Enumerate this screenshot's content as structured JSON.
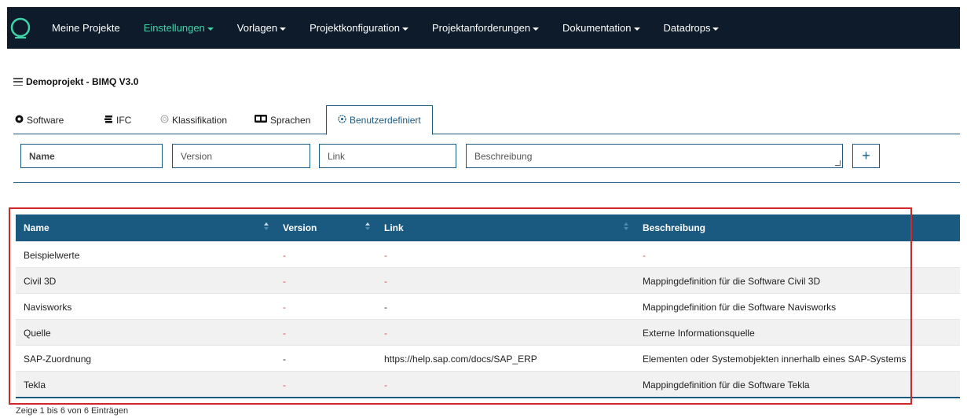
{
  "nav": {
    "items": [
      {
        "label": "Meine Projekte",
        "caret": false,
        "active": false
      },
      {
        "label": "Einstellungen",
        "caret": true,
        "active": true
      },
      {
        "label": "Vorlagen",
        "caret": true,
        "active": false
      },
      {
        "label": "Projektkonfiguration",
        "caret": true,
        "active": false
      },
      {
        "label": "Projektanforderungen",
        "caret": true,
        "active": false
      },
      {
        "label": "Dokumentation",
        "caret": true,
        "active": false
      },
      {
        "label": "Datadrops",
        "caret": true,
        "active": false
      }
    ]
  },
  "project": {
    "title": "Demoprojekt - BIMQ V3.0"
  },
  "tabs": [
    {
      "label": "Software",
      "icon": "software-icon"
    },
    {
      "label": "IFC",
      "icon": "ifc-stack-icon"
    },
    {
      "label": "Klassifikation",
      "icon": "classification-icon"
    },
    {
      "label": "Sprachen",
      "icon": "language-icon"
    },
    {
      "label": "Benutzerdefiniert",
      "icon": "custom-icon"
    }
  ],
  "form": {
    "name_placeholder": "Name",
    "version_placeholder": "Version",
    "link_placeholder": "Link",
    "description_placeholder": "Beschreibung",
    "add_label": "+"
  },
  "table": {
    "headers": [
      "Name",
      "Version",
      "Link",
      "Beschreibung"
    ],
    "rows": [
      {
        "name": "Beispielwerte",
        "version": "-",
        "link": "-",
        "description": "-"
      },
      {
        "name": "Civil 3D",
        "version": "-",
        "link": "-",
        "description": "Mappingdefinition für die Software Civil 3D"
      },
      {
        "name": "Navisworks",
        "version": "-",
        "link": "-",
        "description": "Mappingdefinition für die Software Navisworks"
      },
      {
        "name": "Quelle",
        "version": "-",
        "link": "-",
        "description": "Externe Informationsquelle"
      },
      {
        "name": "SAP-Zuordnung",
        "version": "-",
        "link": "https://help.sap.com/docs/SAP_ERP",
        "description": "Elementen oder Systemobjekten innerhalb eines SAP-Systems"
      },
      {
        "name": "Tekla",
        "version": "-",
        "link": "-",
        "description": "Mappingdefinition für die Software Tekla"
      }
    ]
  },
  "info": {
    "text": "Zeige 1 bis 6 von 6 Einträgen"
  },
  "colors": {
    "nav_bg": "#0d1b2a",
    "active_nav": "#3fd4a8",
    "header_blue": "#1b5a80",
    "dash_red": "#d9534f"
  }
}
